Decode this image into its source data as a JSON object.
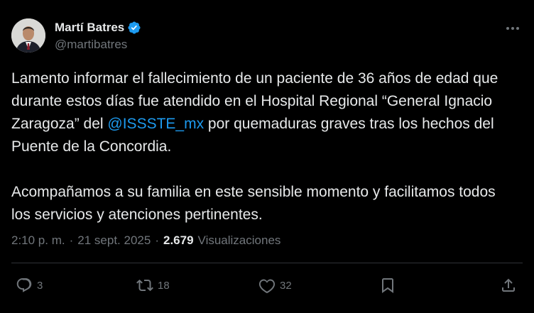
{
  "author": {
    "name": "Martí Batres",
    "handle": "@martibatres",
    "verified": true,
    "badge_color": "#1d9bf0"
  },
  "post": {
    "p1_before": "Lamento informar el fallecimiento de un paciente de 36 años de edad que durante estos días fue atendido en el Hospital Regional “General Ignacio Zaragoza” del ",
    "mention": "@ISSSTE_mx",
    "p1_after": " por quemaduras graves tras los hechos del Puente de la Concordia.",
    "p2": "Acompañamos a su familia en este sensible momento y facilitamos todos los servicios y atenciones pertinentes."
  },
  "meta": {
    "time": "2:10 p. m.",
    "sep1": "·",
    "date": "21 sept. 2025",
    "sep2": "·",
    "views_count": "2.679",
    "views_label": "Visualizaciones"
  },
  "actions": {
    "replies": "3",
    "reposts": "18",
    "likes": "32"
  },
  "icons": [
    "more-icon",
    "verified-badge-icon",
    "reply-icon",
    "repost-icon",
    "like-icon",
    "bookmark-icon",
    "share-icon"
  ],
  "colors": {
    "background": "#000000",
    "text": "#e7e9ea",
    "secondary": "#71767b",
    "link": "#1d9bf0"
  }
}
